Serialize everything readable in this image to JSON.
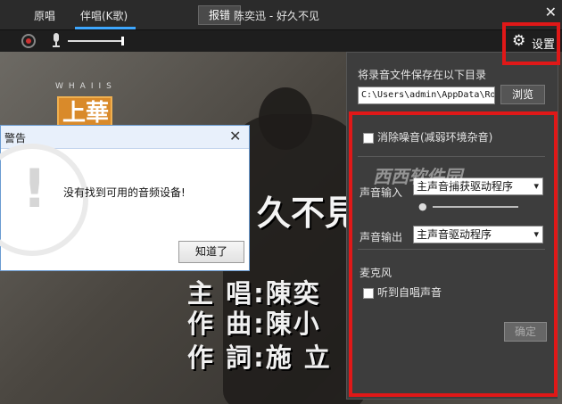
{
  "topbar": {
    "tab_original": "原唱",
    "tab_accompany": "伴唱(K歌)",
    "report_btn": "报错",
    "song_title": "陈奕迅 - 好久不见",
    "close_glyph": "✕"
  },
  "controls": {
    "settings_label": "设置",
    "gear_glyph": "⚙"
  },
  "video": {
    "logo_small": "WHAIIS",
    "logo_text": "上華",
    "subtitle": "久不見",
    "credit_singer": "主  唱:陳奕",
    "credit_composer": "作  曲:陳小",
    "credit_lyricist": "作  詞:施    立",
    "watermark": "西西软件园"
  },
  "settings_panel": {
    "save_dir_label": "将录音文件保存在以下目录",
    "save_path": "C:\\Users\\admin\\AppData\\Ro",
    "browse_btn": "浏览",
    "noise_reduction_label": "消除噪音(减弱环境杂音)",
    "noise_reduction_checked": false,
    "input_label": "声音输入",
    "input_value": "主声音捕获驱动程序",
    "output_label": "声音输出",
    "output_value": "主声音驱动程序",
    "mic_header": "麦克风",
    "hear_self_label": "听到自唱声音",
    "hear_self_checked": false,
    "ok_btn": "确定"
  },
  "dialog": {
    "title": "警告",
    "close_glyph": "✕",
    "message": "没有找到可用的音频设备!",
    "ok_btn": "知道了",
    "icon_glyph": "!"
  },
  "colors": {
    "highlight": "#e01818",
    "tab_underline": "#3da7ff"
  }
}
